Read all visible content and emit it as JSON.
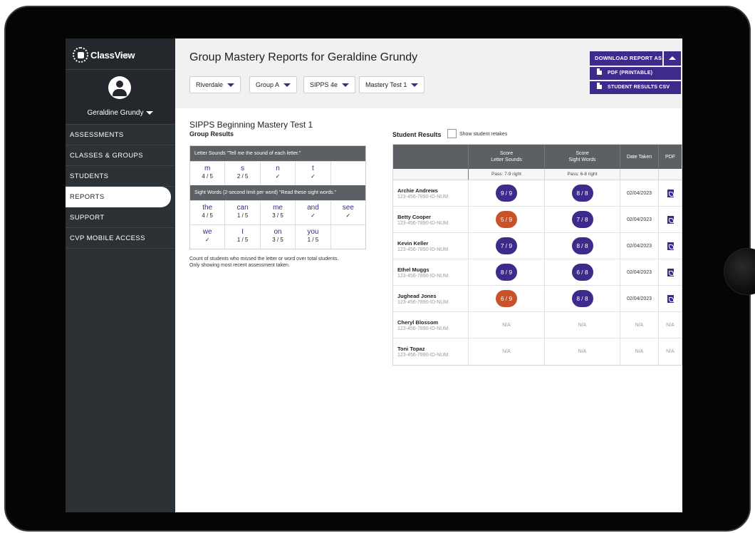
{
  "app": {
    "logo_text": "ClassView",
    "logo_sub": "PRO"
  },
  "user": {
    "name": "Geraldine Grundy"
  },
  "sidebar": {
    "items": [
      {
        "label": "ASSESSMENTS"
      },
      {
        "label": "CLASSES & GROUPS"
      },
      {
        "label": "STUDENTS"
      },
      {
        "label": "REPORTS",
        "active": true
      },
      {
        "label": "SUPPORT"
      },
      {
        "label": "CVP MOBILE ACCESS"
      }
    ]
  },
  "header": {
    "title": "Group Mastery Reports for Geraldine Grundy",
    "filters": [
      {
        "value": "Riverdale"
      },
      {
        "value": "Group A"
      },
      {
        "value": "SIPPS 4e"
      },
      {
        "value": "Mastery Test 1"
      }
    ],
    "download_label": "DOWNLOAD REPORT AS",
    "download_options": [
      {
        "label": "PDF (PRINTABLE)"
      },
      {
        "label": "STUDENT RESULTS CSV"
      }
    ]
  },
  "group": {
    "test_title": "SIPPS Beginning Mastery Test 1",
    "section_label": "Group Results",
    "letter_header": "Letter Sounds \"Tell me the sound of each letter.\"",
    "letters": [
      {
        "item": "m",
        "value": "4 / 5"
      },
      {
        "item": "s",
        "value": "2 / 5"
      },
      {
        "item": "n",
        "value": "✓"
      },
      {
        "item": "t",
        "value": "✓"
      },
      {
        "item": "",
        "value": ""
      }
    ],
    "words_header": "Sight Words (2-second limit per word) \"Read these sight words.\"",
    "words_row1": [
      {
        "item": "the",
        "value": "4 / 5"
      },
      {
        "item": "can",
        "value": "1 / 5"
      },
      {
        "item": "me",
        "value": "3 / 5"
      },
      {
        "item": "and",
        "value": "✓"
      },
      {
        "item": "see",
        "value": "✓"
      }
    ],
    "words_row2": [
      {
        "item": "we",
        "value": "✓"
      },
      {
        "item": "I",
        "value": "1 / 5"
      },
      {
        "item": "on",
        "value": "3 / 5"
      },
      {
        "item": "you",
        "value": "1 / 5"
      },
      {
        "item": "",
        "value": ""
      }
    ],
    "note_line1": "Count of students who missed the letter or word over total students.",
    "note_line2": "Only showing most recent assessment taken."
  },
  "results": {
    "label": "Student Results",
    "retake_label": "Show student retakes",
    "columns": {
      "ls_line1": "Score",
      "ls_line2": "Letter Sounds",
      "sw_line1": "Score",
      "sw_line2": "Sight Words",
      "date": "Date Taken",
      "pdf": "PDF"
    },
    "pass": {
      "ls": "Pass: 7-9 right",
      "sw": "Pass: 6-8 right"
    },
    "colors": {
      "pass": "#3d2a8a",
      "fail": "#c9522a"
    },
    "students": [
      {
        "name": "Archie Andrews",
        "id": "123-456-7890-ID-NUM",
        "ls_score": "9",
        "ls_total": "/ 9",
        "ls_pass": true,
        "sw_score": "8",
        "sw_total": "/ 8",
        "sw_pass": true,
        "date": "02/04/2023",
        "has_pdf": true
      },
      {
        "name": "Betty Cooper",
        "id": "123-456-7890-ID-NUM",
        "ls_score": "5",
        "ls_total": "/ 9",
        "ls_pass": false,
        "sw_score": "7",
        "sw_total": "/ 8",
        "sw_pass": true,
        "date": "02/04/2023",
        "has_pdf": true
      },
      {
        "name": "Kevin Keller",
        "id": "123-456-7890-ID-NUM",
        "ls_score": "7",
        "ls_total": "/ 9",
        "ls_pass": true,
        "sw_score": "8",
        "sw_total": "/ 8",
        "sw_pass": true,
        "date": "02/04/2023",
        "has_pdf": true
      },
      {
        "name": "Ethel Muggs",
        "id": "123-456-7890-ID-NUM",
        "ls_score": "8",
        "ls_total": "/ 9",
        "ls_pass": true,
        "sw_score": "6",
        "sw_total": "/ 8",
        "sw_pass": true,
        "date": "02/04/2023",
        "has_pdf": true
      },
      {
        "name": "Jughead Jones",
        "id": "123-456-7890-ID-NUM",
        "ls_score": "6",
        "ls_total": "/ 9",
        "ls_pass": false,
        "sw_score": "8",
        "sw_total": "/ 8",
        "sw_pass": true,
        "date": "02/04/2023",
        "has_pdf": true
      },
      {
        "name": "Cheryl Blossom",
        "id": "123-456-7890-ID-NUM",
        "na": "N/A"
      },
      {
        "name": "Toni Topaz",
        "id": "123-456-7890-ID-NUM",
        "na": "N/A"
      }
    ]
  }
}
